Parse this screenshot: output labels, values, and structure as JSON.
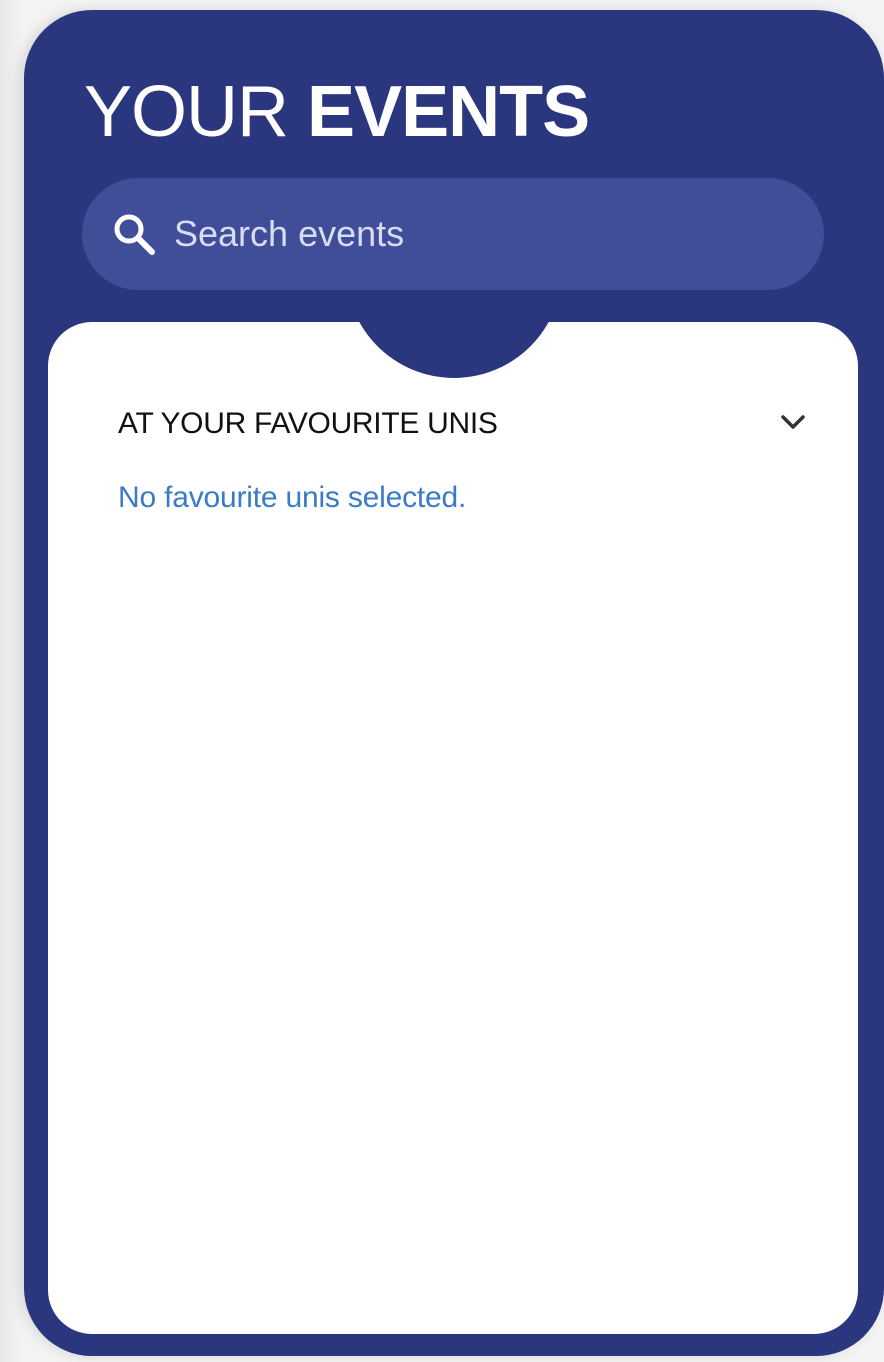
{
  "header": {
    "title_light": "YOUR",
    "title_bold": "EVENTS"
  },
  "search": {
    "placeholder": "Search events",
    "value": "",
    "icon": "search-icon"
  },
  "section": {
    "title": "AT YOUR FAVOURITE UNIS",
    "toggle_icon": "chevron-down-icon",
    "empty_message": "No favourite unis selected."
  },
  "colors": {
    "card_background": "#2a367e",
    "search_background": "#404e99",
    "content_background": "#ffffff",
    "link_text": "#3a7bc8",
    "header_text": "#ffffff"
  }
}
